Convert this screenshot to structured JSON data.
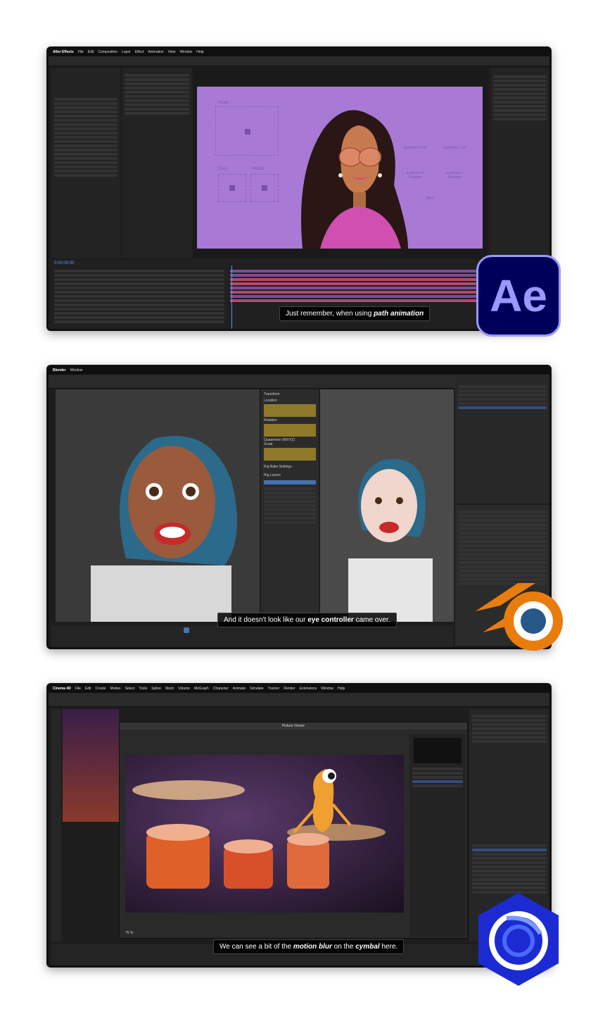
{
  "ae": {
    "menu": [
      "After Effects",
      "File",
      "Edit",
      "Composition",
      "Layer",
      "Effect",
      "Animation",
      "View",
      "Window",
      "Help"
    ],
    "comp_labels": [
      "Head",
      "Eyes",
      "Mouth",
      "Eyebrow R Lift",
      "Eyebrow L Lift",
      "Eyebrow R Rotation",
      "Eyebrow L Rotation",
      "Blink"
    ],
    "timecode": "0:00:00:00",
    "subtitle_pre": "Just remember, when using ",
    "subtitle_em": "path animation",
    "logo_text": "Ae",
    "colors": {
      "comp_bg": "#a87ad6",
      "logo_bg": "#00005b",
      "logo_fg": "#9999ff"
    }
  },
  "blender": {
    "menu": [
      "Blender",
      "Window"
    ],
    "subtitle_pre": "And it doesn't look like our ",
    "subtitle_em": "eye controller",
    "subtitle_post": " came over.",
    "props": [
      "Transform",
      "Location",
      "Rotation",
      "Quaternion (WXYZ)",
      "Scale",
      "Rig Bake Settings",
      "Rig Layers"
    ],
    "colors": {
      "logo_orange": "#e87d0d",
      "logo_blue": "#265787"
    }
  },
  "c4d": {
    "menu": [
      "Cinema 4D",
      "File",
      "Edit",
      "Create",
      "Modes",
      "Select",
      "Tools",
      "Spline",
      "Mesh",
      "Volume",
      "MoGraph",
      "Character",
      "Animate",
      "Simulate",
      "Tracker",
      "Render",
      "Extensions",
      "Window",
      "Help"
    ],
    "picture_viewer_title": "Picture Viewer",
    "subtitle_pre": "We can see a bit of the ",
    "subtitle_em": "motion blur",
    "subtitle_post": " on the ",
    "subtitle_em2": "cymbal",
    "subtitle_end": " here.",
    "zoom": "75 %",
    "colors": {
      "logo_blue": "#1b2bd1"
    }
  }
}
